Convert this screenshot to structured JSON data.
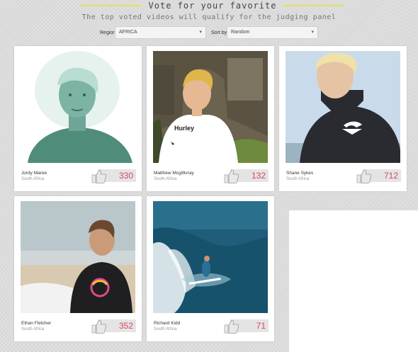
{
  "header": {
    "title": "Vote for your favorite",
    "subtitle": "The top voted videos will qualify for the judging panel"
  },
  "filters": {
    "region_label": "Region",
    "region_value": "AFRICA",
    "sort_label": "Sort by",
    "sort_value": "Random"
  },
  "colors": {
    "accent_line": "#e6e05a",
    "vote_count": "#d9475c"
  },
  "cards": [
    {
      "name": "Jordy Maree",
      "country": "South Africa",
      "votes": "330",
      "photo": "teal-tinted-portrait"
    },
    {
      "name": "Matthew Mcgillivray",
      "country": "South Africa",
      "votes": "132",
      "photo": "hurley-shirt-portrait"
    },
    {
      "name": "Shane Sykes",
      "country": "South Africa",
      "votes": "712",
      "photo": "wetsuit-portrait"
    },
    {
      "name": "Ethan Fletcher",
      "country": "South Africa",
      "votes": "352",
      "photo": "beach-surfboard"
    },
    {
      "name": "Richard Kidd",
      "country": "South Africa",
      "votes": "71",
      "photo": "surfing-wave"
    }
  ]
}
